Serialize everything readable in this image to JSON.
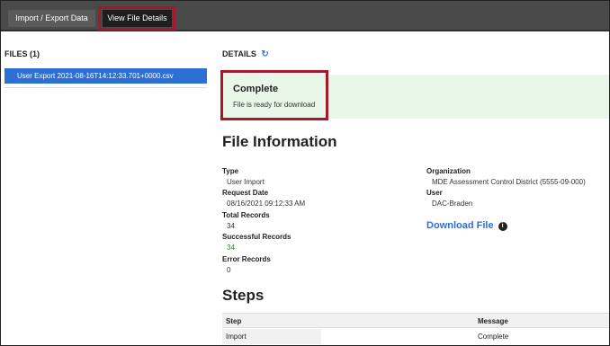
{
  "tabs": [
    {
      "label": "Import / Export Data",
      "active": false
    },
    {
      "label": "View File Details",
      "active": true
    }
  ],
  "files": {
    "header": "FILES (1)",
    "items": [
      "User Export 2021-08-16T14:12:33.701+0000.csv"
    ]
  },
  "details": {
    "header": "DETAILS",
    "refresh_icon": "refresh-icon"
  },
  "status": {
    "title": "Complete",
    "message": "File is ready for download"
  },
  "file_information": {
    "title": "File Information",
    "type_label": "Type",
    "type_value": "User Import",
    "request_date_label": "Request Date",
    "request_date_value": "08/16/2021 09:12:33 AM",
    "total_records_label": "Total Records",
    "total_records_value": "34",
    "successful_records_label": "Successful Records",
    "successful_records_value": "34",
    "error_records_label": "Error Records",
    "error_records_value": "0",
    "organization_label": "Organization",
    "organization_value": "MDE Assessment Control District (5555-09-000)",
    "user_label": "User",
    "user_value": "DAC-Braden",
    "download_label": "Download File"
  },
  "steps": {
    "title": "Steps",
    "columns": [
      "Step",
      "Message"
    ],
    "rows": [
      {
        "step": "Import",
        "message": "Complete"
      }
    ]
  },
  "colors": {
    "accent_blue": "#2e6fd6",
    "highlight_red": "#a4182a",
    "success_green": "#2e8b3a",
    "banner_bg": "#e8f7e8"
  }
}
